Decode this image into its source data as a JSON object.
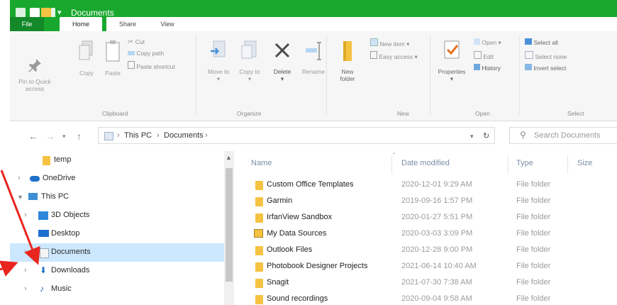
{
  "window": {
    "title": "Documents"
  },
  "ribbon_tabs": {
    "file": "File",
    "home": "Home",
    "share": "Share",
    "view": "View"
  },
  "ribbon": {
    "clipboard": {
      "pin_to_quick_access": "Pin to Quick access",
      "copy": "Copy",
      "paste": "Paste",
      "cut": "Cut",
      "copy_path": "Copy path",
      "paste_shortcut": "Paste shortcut",
      "group": "Clipboard"
    },
    "organize": {
      "move_to": "Move to",
      "copy_to": "Copy to",
      "delete": "Delete",
      "rename": "Rename",
      "group": "Organize"
    },
    "new": {
      "new_folder": "New folder",
      "new_item": "New item",
      "easy_access": "Easy access",
      "group": "New"
    },
    "open": {
      "properties": "Properties",
      "open": "Open",
      "edit": "Edit",
      "history": "History",
      "group": "Open"
    },
    "select": {
      "select_all": "Select all",
      "select_none": "Select none",
      "invert_selection": "Invert select",
      "group": "Select"
    }
  },
  "address": {
    "crumbs": [
      "This PC",
      "Documents"
    ],
    "search_placeholder": "Search Documents"
  },
  "nav_pane": {
    "items": [
      {
        "label": "temp",
        "icon": "folder-icon"
      },
      {
        "label": "OneDrive",
        "icon": "cloud-icon"
      },
      {
        "label": "This PC",
        "icon": "computer-icon"
      },
      {
        "label": "3D Objects",
        "icon": "cube-icon"
      },
      {
        "label": "Desktop",
        "icon": "desktop-icon"
      },
      {
        "label": "Documents",
        "icon": "document-icon",
        "selected": true
      },
      {
        "label": "Downloads",
        "icon": "download-icon"
      },
      {
        "label": "Music",
        "icon": "music-icon"
      }
    ]
  },
  "file_list": {
    "columns": {
      "name": "Name",
      "date": "Date modified",
      "type": "Type",
      "size": "Size"
    },
    "rows": [
      {
        "name": "Custom Office Templates",
        "date": "2020-12-01 9:29 AM",
        "type": "File folder",
        "icon": "folder-icon"
      },
      {
        "name": "Garmin",
        "date": "2019-09-16 1:57 PM",
        "type": "File folder",
        "icon": "folder-icon"
      },
      {
        "name": "IrfanView Sandbox",
        "date": "2020-01-27 5:51 PM",
        "type": "File folder",
        "icon": "folder-icon"
      },
      {
        "name": "My Data Sources",
        "date": "2020-03-03 3:09 PM",
        "type": "File folder",
        "icon": "data-sources-icon"
      },
      {
        "name": "Outlook Files",
        "date": "2020-12-28 9:00 PM",
        "type": "File folder",
        "icon": "folder-icon"
      },
      {
        "name": "Photobook Designer Projects",
        "date": "2021-06-14 10:40 AM",
        "type": "File folder",
        "icon": "folder-icon"
      },
      {
        "name": "Snagit",
        "date": "2021-07-30 7:38 AM",
        "type": "File folder",
        "icon": "folder-icon"
      },
      {
        "name": "Sound recordings",
        "date": "2020-09-04 9:58 AM",
        "type": "File folder",
        "icon": "folder-icon"
      }
    ]
  },
  "colors": {
    "title_bar": "#18a82e",
    "selection": "#cce8ff",
    "annotation_arrow": "#e8251e"
  }
}
